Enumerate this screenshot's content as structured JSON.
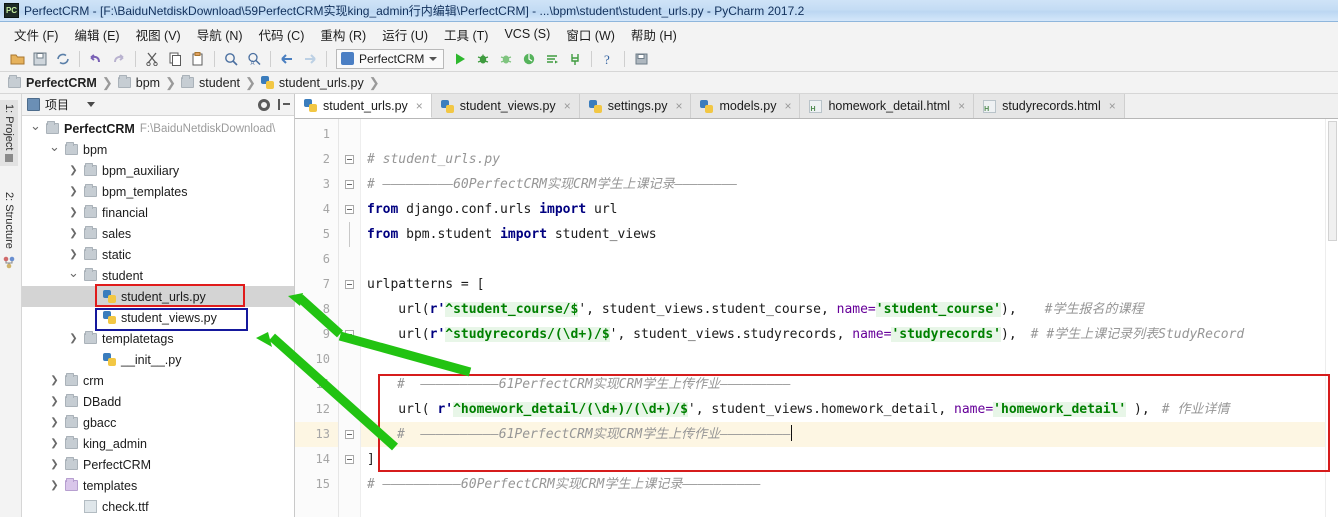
{
  "window": {
    "title": "PerfectCRM - [F:\\BaiduNetdiskDownload\\59PerfectCRM实现king_admin行内编辑\\PerfectCRM] - ...\\bpm\\student\\student_urls.py - PyCharm 2017.2",
    "app_icon_label": "PC"
  },
  "menubar": {
    "items": [
      {
        "label": "文件 (F)"
      },
      {
        "label": "编辑 (E)"
      },
      {
        "label": "视图 (V)"
      },
      {
        "label": "导航 (N)"
      },
      {
        "label": "代码 (C)"
      },
      {
        "label": "重构 (R)"
      },
      {
        "label": "运行 (U)"
      },
      {
        "label": "工具 (T)"
      },
      {
        "label": "VCS (S)"
      },
      {
        "label": "窗口 (W)"
      },
      {
        "label": "帮助 (H)"
      }
    ]
  },
  "toolbar": {
    "run_config_label": "PerfectCRM",
    "run_config_icon": "module-icon",
    "buttons": [
      "open-folder-icon",
      "save-all-icon",
      "sync-icon",
      "undo-icon",
      "redo-icon",
      "cut-icon",
      "copy-icon",
      "paste-icon",
      "find-icon",
      "find-replace-icon",
      "back-icon",
      "forward-icon"
    ],
    "run_buttons": [
      "run-icon",
      "debug-icon",
      "coverage-icon",
      "profile-icon",
      "run-with-console-icon",
      "attach-icon"
    ],
    "help_icon": "help-icon",
    "settings_icon": "settings-icon"
  },
  "breadcrumb": {
    "items": [
      {
        "label": "PerfectCRM",
        "icon": "folder-icon",
        "bold": true
      },
      {
        "label": "bpm",
        "icon": "folder-icon",
        "bold": false
      },
      {
        "label": "student",
        "icon": "folder-icon",
        "bold": false
      },
      {
        "label": "student_urls.py",
        "icon": "python-file-icon",
        "bold": false
      }
    ],
    "separator": "❯"
  },
  "vertical_tabs": [
    {
      "label": "1: Project",
      "selected": true
    },
    {
      "label": "2: Structure",
      "selected": false
    }
  ],
  "project_panel": {
    "title": "项目",
    "gear_icon": "gear-icon",
    "collapse_icon": "collapse-all-icon",
    "tree": [
      {
        "indent": 0,
        "arrow": "down",
        "icon": "folder-icon",
        "label": "PerfectCRM",
        "bold": true,
        "path": "F:\\BaiduNetdiskDownload\\",
        "selected": false
      },
      {
        "indent": 1,
        "arrow": "down",
        "icon": "folder-icon",
        "label": "bpm",
        "bold": false,
        "path": "",
        "selected": false
      },
      {
        "indent": 2,
        "arrow": "right",
        "icon": "folder-icon",
        "label": "bpm_auxiliary",
        "bold": false,
        "path": "",
        "selected": false
      },
      {
        "indent": 2,
        "arrow": "right",
        "icon": "folder-icon",
        "label": "bpm_templates",
        "bold": false,
        "path": "",
        "selected": false
      },
      {
        "indent": 2,
        "arrow": "right",
        "icon": "folder-icon",
        "label": "financial",
        "bold": false,
        "path": "",
        "selected": false
      },
      {
        "indent": 2,
        "arrow": "right",
        "icon": "folder-icon",
        "label": "sales",
        "bold": false,
        "path": "",
        "selected": false
      },
      {
        "indent": 2,
        "arrow": "right",
        "icon": "folder-icon",
        "label": "static",
        "bold": false,
        "path": "",
        "selected": false
      },
      {
        "indent": 2,
        "arrow": "down",
        "icon": "folder-icon",
        "label": "student",
        "bold": false,
        "path": "",
        "selected": false
      },
      {
        "indent": 3,
        "arrow": "none",
        "icon": "python-file-icon",
        "label": "student_urls.py",
        "bold": false,
        "path": "",
        "selected": true
      },
      {
        "indent": 3,
        "arrow": "none",
        "icon": "python-file-icon",
        "label": "student_views.py",
        "bold": false,
        "path": "",
        "selected": false
      },
      {
        "indent": 2,
        "arrow": "right",
        "icon": "folder-icon",
        "label": "templatetags",
        "bold": false,
        "path": "",
        "selected": false
      },
      {
        "indent": 3,
        "arrow": "none",
        "icon": "python-file-icon",
        "label": "__init__.py",
        "bold": false,
        "path": "",
        "selected": false
      },
      {
        "indent": 1,
        "arrow": "right",
        "icon": "folder-icon",
        "label": "crm",
        "bold": false,
        "path": "",
        "selected": false
      },
      {
        "indent": 1,
        "arrow": "right",
        "icon": "folder-icon",
        "label": "DBadd",
        "bold": false,
        "path": "",
        "selected": false
      },
      {
        "indent": 1,
        "arrow": "right",
        "icon": "folder-icon",
        "label": "gbacc",
        "bold": false,
        "path": "",
        "selected": false
      },
      {
        "indent": 1,
        "arrow": "right",
        "icon": "folder-icon",
        "label": "king_admin",
        "bold": false,
        "path": "",
        "selected": false
      },
      {
        "indent": 1,
        "arrow": "right",
        "icon": "folder-icon",
        "label": "PerfectCRM",
        "bold": false,
        "path": "",
        "selected": false
      },
      {
        "indent": 1,
        "arrow": "right",
        "icon": "folder-purple-icon",
        "label": "templates",
        "bold": false,
        "path": "",
        "selected": false
      },
      {
        "indent": 2,
        "arrow": "none",
        "icon": "font-file-icon",
        "label": "check.ttf",
        "bold": false,
        "path": "",
        "selected": false
      }
    ]
  },
  "editor_tabs": [
    {
      "label": "student_urls.py",
      "icon": "python-file-icon",
      "active": true,
      "close": "×"
    },
    {
      "label": "student_views.py",
      "icon": "python-file-icon",
      "active": false,
      "close": "×"
    },
    {
      "label": "settings.py",
      "icon": "python-file-icon",
      "active": false,
      "close": "×"
    },
    {
      "label": "models.py",
      "icon": "python-file-icon",
      "active": false,
      "close": "×"
    },
    {
      "label": "homework_detail.html",
      "icon": "html-file-icon",
      "active": false,
      "close": "×"
    },
    {
      "label": "studyrecords.html",
      "icon": "html-file-icon",
      "active": false,
      "close": "×"
    }
  ],
  "code": {
    "line_numbers": [
      "1",
      "2",
      "3",
      "4",
      "5",
      "6",
      "7",
      "8",
      "9",
      "10",
      "11",
      "12",
      "13",
      "14",
      "15"
    ],
    "current_line": 13,
    "lines": {
      "l2_comment": "# student_urls.py",
      "l3_comment": "# —————————60PerfectCRM实现CRM学生上课记录————————",
      "l4_from": "from",
      "l4_mod": " django.conf.urls ",
      "l4_import": "import",
      "l4_name": " url",
      "l5_from": "from",
      "l5_mod": " bpm.student ",
      "l5_import": "import",
      "l5_name": " student_views",
      "l7_text": "urlpatterns = [",
      "l8_call": "    url(",
      "l8_rprefix": "r'",
      "l8_regex": "^student_course/$",
      "l8_mid": "', student_views.student_course, ",
      "l8_name_kw": "name=",
      "l8_name_val": "'student_course'",
      "l8_tail": "),",
      "l8_comment": "#学生报名的课程",
      "l9_call": "    url(",
      "l9_rprefix": "r'",
      "l9_regex": "^studyrecords/(\\d+)/$",
      "l9_mid": "', student_views.studyrecords, ",
      "l9_name_kw": "name=",
      "l9_name_val": "'studyrecords'",
      "l9_tail": "),",
      "l9_comment": "# #学生上课记录列表StudyRecord",
      "l11_comment": "#  ——————————61PerfectCRM实现CRM学生上传作业—————————",
      "l12_call": "    url( ",
      "l12_rprefix": "r'",
      "l12_regex": "^homework_detail/(\\d+)/(\\d+)/$",
      "l12_mid": "', student_views.homework_detail, ",
      "l12_name_kw": "name=",
      "l12_name_val": "'homework_detail'",
      "l12_tail": " ),",
      "l12_comment": "# 作业详情",
      "l13_comment": "#  ——————————61PerfectCRM实现CRM学生上传作业—————————",
      "l14_text": "]",
      "l15_comment": "# ——————————60PerfectCRM实现CRM学生上课记录——————————"
    }
  },
  "annotations": {
    "red_box_tree_label": "highlight-student-urls",
    "blue_box_tree_label": "highlight-student-views",
    "red_box_code_label": "highlight-homework-detail-block",
    "arrow_color": "#22c312",
    "red_color": "#e01b1b",
    "blue_color": "#15189c"
  }
}
